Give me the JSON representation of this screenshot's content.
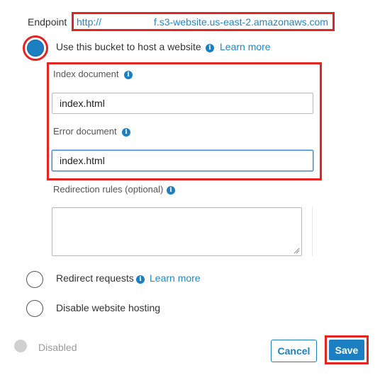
{
  "endpoint": {
    "label": "Endpoint",
    "url_prefix": "http://",
    "url_suffix": "f.s3-website.us-east-2.amazonaws.com"
  },
  "host_option": {
    "label": "Use this bucket to host a website",
    "learn_more": "Learn more",
    "selected": true
  },
  "index_document": {
    "label": "Index document",
    "value": "index.html"
  },
  "error_document": {
    "label": "Error document",
    "value": "index.html"
  },
  "redirection_rules": {
    "label": "Redirection rules (optional)",
    "value": ""
  },
  "redirect_option": {
    "label": "Redirect requests",
    "learn_more": "Learn more"
  },
  "disable_option": {
    "label": "Disable website hosting"
  },
  "status": {
    "label": "Disabled"
  },
  "buttons": {
    "cancel": "Cancel",
    "save": "Save"
  },
  "colors": {
    "accent": "#1e88c7",
    "primary_button": "#1b7fc1",
    "highlight": "#e52321"
  }
}
